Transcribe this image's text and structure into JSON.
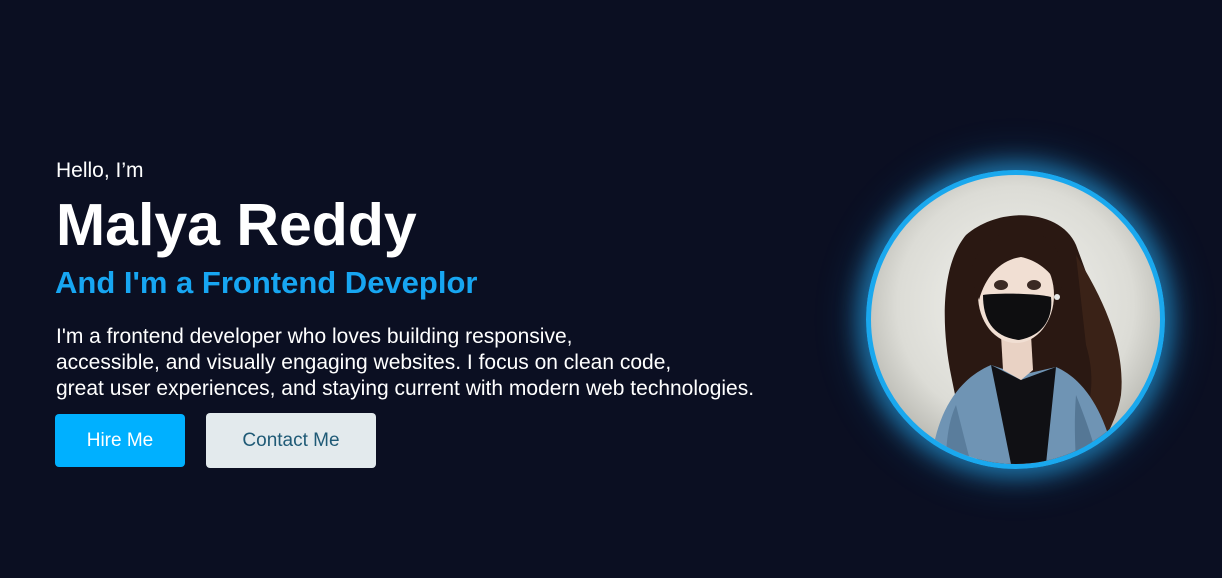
{
  "hero": {
    "greeting": "Hello, I’m",
    "name": "Malya Reddy",
    "role": "And I'm a Frontend Deveplor",
    "bio": "I'm a frontend developer who loves building responsive,\naccessible, and visually engaging websites. I focus on clean code,\ngreat user experiences, and staying current with modern web technologies.",
    "hire_label": "Hire Me",
    "contact_label": "Contact Me"
  },
  "colors": {
    "background": "#0b0f22",
    "accent": "#17a6f2",
    "hire_button": "#00b0ff",
    "contact_button": "#e3eaed",
    "contact_text": "#1f5a76"
  },
  "avatar": {
    "icon": "profile-illustration"
  }
}
